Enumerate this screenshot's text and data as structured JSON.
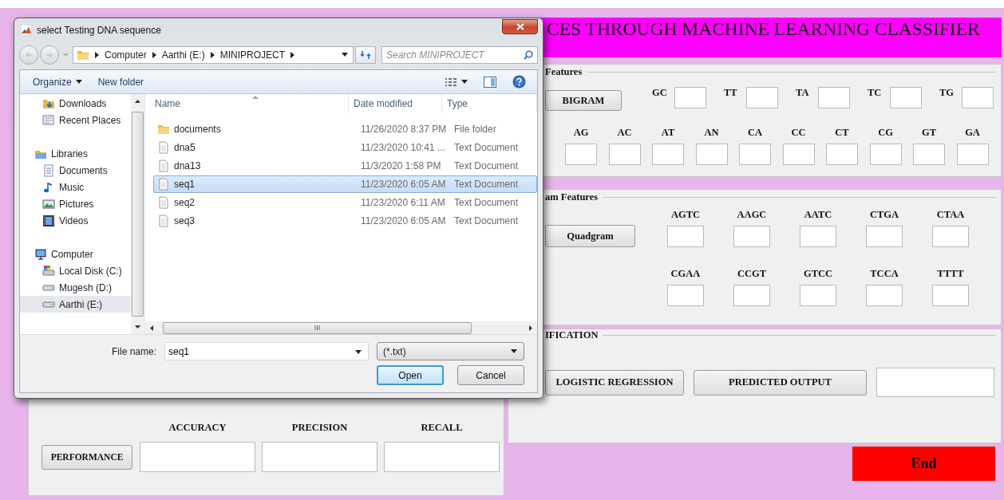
{
  "app": {
    "title": "CES THROUGH MACHINE LEARNING CLASSIFIER",
    "bigram_panel": {
      "legend": "Features",
      "button": "BIGRAM",
      "row_1": [
        {
          "label": "GC"
        },
        {
          "label": "TT"
        },
        {
          "label": "TA"
        },
        {
          "label": "TC"
        },
        {
          "label": "TG"
        }
      ],
      "row_2": [
        {
          "label": "AG"
        },
        {
          "label": "AC"
        },
        {
          "label": "AT"
        },
        {
          "label": "AN"
        },
        {
          "label": "CA"
        },
        {
          "label": "CC"
        },
        {
          "label": "CT"
        },
        {
          "label": "CG"
        },
        {
          "label": "GT"
        },
        {
          "label": "GA"
        }
      ]
    },
    "quadgram_panel": {
      "legend": "am Features",
      "button": "Quadgram",
      "row_1": [
        {
          "label": "AGTC"
        },
        {
          "label": "AAGC"
        },
        {
          "label": "AATC"
        },
        {
          "label": "CTGA"
        },
        {
          "label": "CTAA"
        }
      ],
      "row_2": [
        {
          "label": "CGAA"
        },
        {
          "label": "CCGT"
        },
        {
          "label": "GTCC"
        },
        {
          "label": "TCCA"
        },
        {
          "label": "TTTT"
        }
      ]
    },
    "classification_panel": {
      "legend": "IFICATION",
      "buttons": [
        "LOGISTIC REGRESSION",
        "PREDICTED OUTPUT"
      ]
    },
    "performance_panel": {
      "button": "PERFORMANCE",
      "metrics": [
        "ACCURACY",
        "PRECISION",
        "RECALL"
      ]
    },
    "end_button": "End"
  },
  "dialog": {
    "title": "select Testing DNA sequence",
    "breadcrumbs": [
      "Computer",
      "Aarthi (E:)",
      "MINIPROJECT"
    ],
    "search": {
      "placeholder": "Search MINIPROJECT"
    },
    "toolbar": [
      "Organize",
      "New folder"
    ],
    "nav_sections": [
      {
        "items": [
          {
            "label": "Downloads",
            "selected": false
          },
          {
            "label": "Recent Places",
            "selected": false
          }
        ]
      },
      {
        "header": "Libraries",
        "items": [
          {
            "label": "Documents",
            "selected": false
          },
          {
            "label": "Music",
            "selected": false
          },
          {
            "label": "Pictures",
            "selected": false
          },
          {
            "label": "Videos",
            "selected": false
          }
        ]
      },
      {
        "header": "Computer",
        "items": [
          {
            "label": "Local Disk (C:)",
            "selected": false
          },
          {
            "label": "Mugesh (D:)",
            "selected": false
          },
          {
            "label": "Aarthi (E:)",
            "selected": true
          }
        ]
      }
    ],
    "columns": [
      "Name",
      "Date modified",
      "Type"
    ],
    "files": [
      {
        "name": "documents",
        "date": "11/26/2020 8:37 PM",
        "type": "File folder",
        "kind": "folder",
        "selected": false
      },
      {
        "name": "dna5",
        "date": "11/23/2020 10:41 ...",
        "type": "Text Document",
        "kind": "file",
        "selected": false
      },
      {
        "name": "dna13",
        "date": "11/3/2020 1:58 PM",
        "type": "Text Document",
        "kind": "file",
        "selected": false
      },
      {
        "name": "seq1",
        "date": "11/23/2020 6:05 AM",
        "type": "Text Document",
        "kind": "file",
        "selected": true
      },
      {
        "name": "seq2",
        "date": "11/23/2020 6:11 AM",
        "type": "Text Document",
        "kind": "file",
        "selected": false
      },
      {
        "name": "seq3",
        "date": "11/23/2020 6:05 AM",
        "type": "Text Document",
        "kind": "file",
        "selected": false
      }
    ],
    "file_name_label": "File name:",
    "file_name": "seq1",
    "filter": "(*.txt)",
    "buttons": [
      {
        "label": "Open",
        "default": true
      },
      {
        "label": "Cancel",
        "default": false
      }
    ]
  }
}
